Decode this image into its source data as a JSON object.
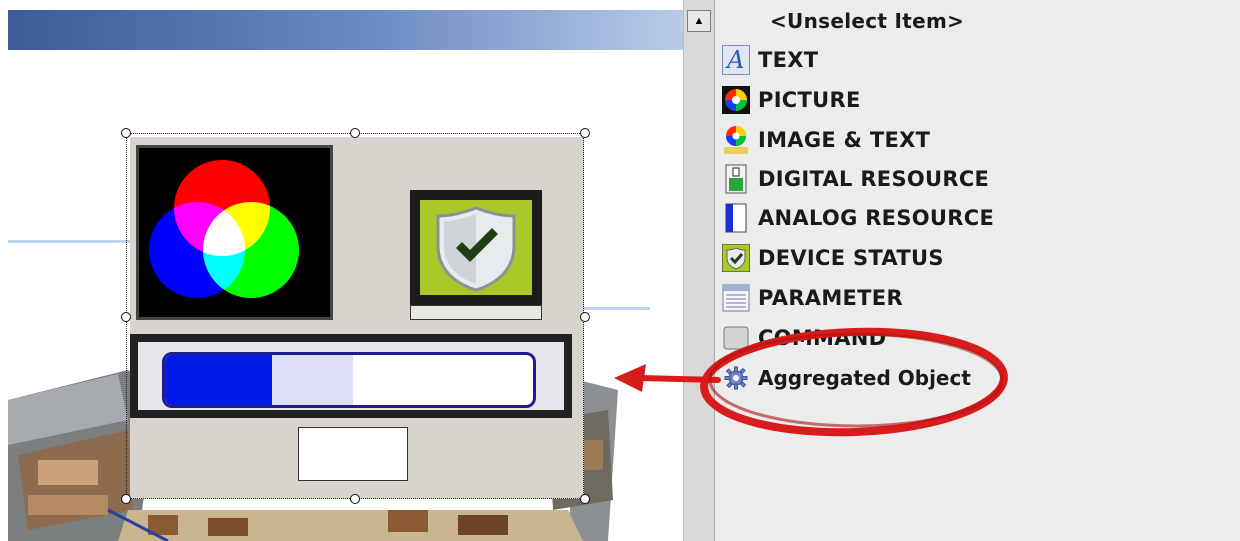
{
  "palette": {
    "scroll_up_glyph": "▲",
    "items": [
      {
        "label": "<Unselect Item>",
        "icon": "none"
      },
      {
        "label": "TEXT",
        "icon": "text-a-icon"
      },
      {
        "label": "PICTURE",
        "icon": "color-picture-icon"
      },
      {
        "label": "IMAGE & TEXT",
        "icon": "image-text-icon"
      },
      {
        "label": "DIGITAL RESOURCE",
        "icon": "digital-resource-icon"
      },
      {
        "label": "ANALOG RESOURCE",
        "icon": "analog-resource-icon"
      },
      {
        "label": "DEVICE STATUS",
        "icon": "device-status-icon"
      },
      {
        "label": "PARAMETER",
        "icon": "parameter-table-icon"
      },
      {
        "label": "COMMAND",
        "icon": "command-icon"
      },
      {
        "label": "Aggregated Object",
        "icon": "gear-icon"
      }
    ]
  },
  "widget": {
    "progress_fraction": 0.29,
    "colors": {
      "fill": "#0018e8",
      "status_bg": "#a9c92a",
      "highlight": "#d81c1c"
    }
  }
}
